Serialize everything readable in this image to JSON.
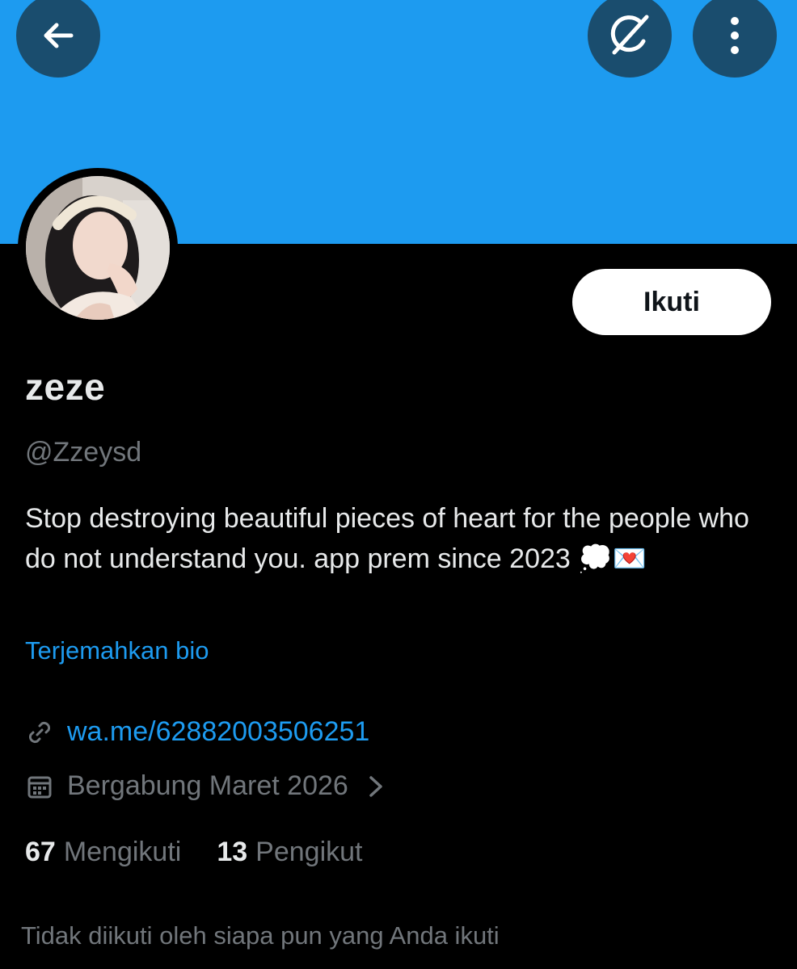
{
  "colors": {
    "banner": "#1d9bf0",
    "button_circle": "#1a4d6e",
    "background": "#000000",
    "link": "#1d9bf0",
    "muted": "#71767b",
    "text": "#e7e9ea"
  },
  "header": {
    "back_icon": "arrow-left-icon",
    "grok_icon": "grok-icon",
    "more_icon": "more-vertical-icon"
  },
  "profile": {
    "follow_label": "Ikuti",
    "display_name": "zeze",
    "handle": "@Zzeysd",
    "bio": "Stop destroying beautiful pieces of heart for the people who do not understand you. app prem since 2023 💭💌",
    "translate_label": "Terjemahkan bio",
    "link_icon": "link-icon",
    "link": "wa.me/62882003506251",
    "calendar_icon": "calendar-icon",
    "joined": "Bergabung Maret 2026",
    "chevron_icon": "chevron-right-icon"
  },
  "stats": {
    "following_count": "67",
    "following_label": "Mengikuti",
    "followers_count": "13",
    "followers_label": "Pengikut"
  },
  "footer_note": "Tidak diikuti oleh siapa pun yang Anda ikuti"
}
